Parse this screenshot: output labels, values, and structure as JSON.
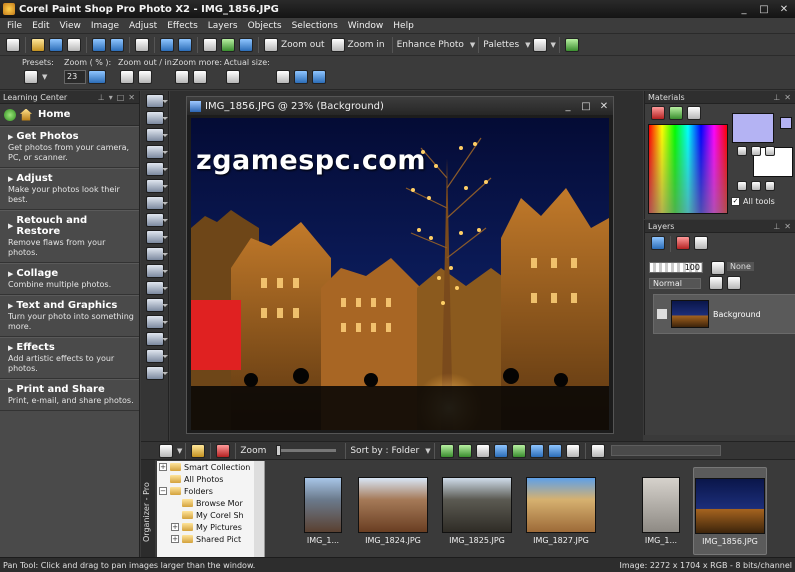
{
  "app": {
    "title": "Corel Paint Shop Pro Photo X2 - IMG_1856.JPG",
    "window_controls": [
      "_",
      "□",
      "✕"
    ]
  },
  "menu": [
    "File",
    "Edit",
    "View",
    "Image",
    "Adjust",
    "Effects",
    "Layers",
    "Objects",
    "Selections",
    "Window",
    "Help"
  ],
  "toolbar": {
    "zoom_out_label": "Zoom out",
    "zoom_in_label": "Zoom in",
    "enhance_label": "Enhance Photo",
    "palettes_label": "Palettes"
  },
  "tool_options": {
    "presets_label": "Presets:",
    "zoom_pct_label": "Zoom ( % ):",
    "zoom_value": "23",
    "zoom_out_in_label": "Zoom out / in:",
    "zoom_more_label": "Zoom more:",
    "actual_size_label": "Actual size:"
  },
  "learning_center": {
    "title": "Learning Center",
    "home_label": "Home",
    "items": [
      {
        "title": "Get Photos",
        "desc": "Get photos from your camera, PC, or scanner."
      },
      {
        "title": "Adjust",
        "desc": "Make your photos look their best."
      },
      {
        "title": "Retouch and Restore",
        "desc": "Remove flaws from your photos."
      },
      {
        "title": "Collage",
        "desc": "Combine multiple photos."
      },
      {
        "title": "Text and Graphics",
        "desc": "Turn your photo into something more."
      },
      {
        "title": "Effects",
        "desc": "Add artistic effects to your photos."
      },
      {
        "title": "Print and Share",
        "desc": "Print, e-mail, and share photos."
      }
    ]
  },
  "document": {
    "title": "IMG_1856.JPG @  23% (Background)"
  },
  "watermark": "zgamespc.com",
  "materials": {
    "title": "Materials",
    "all_tools_label": "All tools"
  },
  "layers": {
    "title": "Layers",
    "opacity": "100",
    "blend_mode": "Normal",
    "none_label": "None",
    "layer_name": "Background"
  },
  "organizer": {
    "side_label": "Organizer - Pro",
    "zoom_label": "Zoom",
    "sort_label": "Sort by : Folder",
    "tree": [
      {
        "label": "Smart Collection",
        "pm": "+",
        "indent": 0
      },
      {
        "label": "All Photos",
        "pm": "",
        "indent": 0
      },
      {
        "label": "Folders",
        "pm": "−",
        "indent": 0
      },
      {
        "label": "Browse Mor",
        "pm": "",
        "indent": 1
      },
      {
        "label": "My Corel Sh",
        "pm": "",
        "indent": 1
      },
      {
        "label": "My Pictures",
        "pm": "+",
        "indent": 1
      },
      {
        "label": "Shared Pict",
        "pm": "+",
        "indent": 1
      }
    ],
    "thumbs": [
      {
        "caption": "IMG_1...",
        "selected": false
      },
      {
        "caption": "IMG_1824.JPG",
        "selected": false
      },
      {
        "caption": "IMG_1825.JPG",
        "selected": false
      },
      {
        "caption": "IMG_1827.JPG",
        "selected": false
      },
      {
        "caption": "IMG_1...",
        "selected": false
      },
      {
        "caption": "IMG_1856.JPG",
        "selected": true
      }
    ]
  },
  "status": {
    "left": "Pan Tool: Click and drag to pan images larger than the window.",
    "right": "Image:  2272 x 1704 x RGB - 8 bits/channel"
  }
}
